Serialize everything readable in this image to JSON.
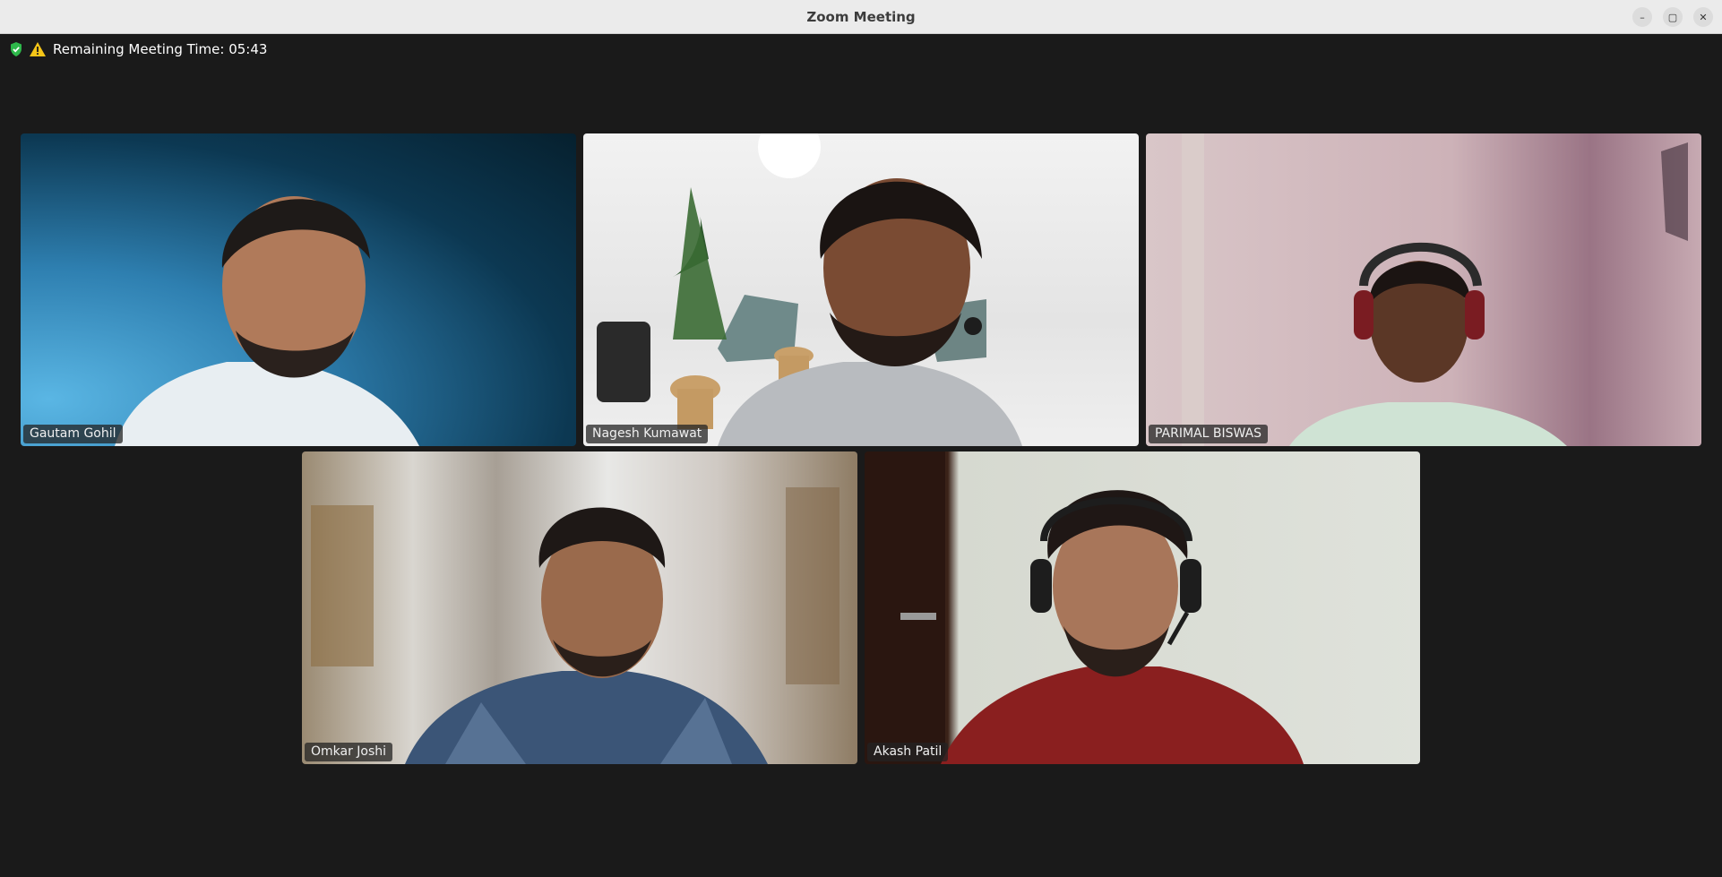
{
  "window": {
    "title": "Zoom Meeting",
    "minimize_label": "–",
    "maximize_label": "▢",
    "close_label": "✕"
  },
  "status": {
    "remaining_time_text": "Remaining Meeting Time: 05:43",
    "encryption_icon": "shield-check-icon",
    "warning_icon": "warning-icon",
    "shield_color": "#2eb84b",
    "warning_color": "#f5c518"
  },
  "participants": [
    {
      "name": "Gautam Gohil"
    },
    {
      "name": "Nagesh Kumawat"
    },
    {
      "name": "PARIMAL BISWAS"
    },
    {
      "name": "Omkar Joshi"
    },
    {
      "name": "Akash Patil"
    }
  ]
}
